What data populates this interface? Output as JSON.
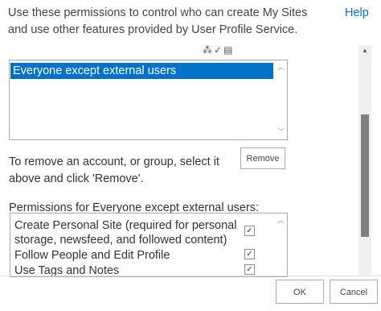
{
  "header": {
    "description": "Use these permissions to control who can create My Sites and use other features provided by User Profile Service.",
    "help_link": "Help"
  },
  "accounts": {
    "items": [
      "Everyone except external users"
    ],
    "selected_index": 0
  },
  "remove": {
    "instruction": "To remove an account, or group, select it above and click 'Remove'.",
    "button_label": "Remove"
  },
  "permissions": {
    "label": "Permissions for Everyone except external users:",
    "items": [
      {
        "label": "Create Personal Site (required for personal storage, newsfeed, and followed content)",
        "checked": true
      },
      {
        "label": "Follow People and Edit Profile",
        "checked": true
      },
      {
        "label": "Use Tags and Notes",
        "checked": true
      }
    ]
  },
  "footer": {
    "ok_label": "OK",
    "cancel_label": "Cancel"
  },
  "icons": {
    "check": "✓",
    "people_picker": "people-icon",
    "address_book": "address-book-icon"
  },
  "colors": {
    "selection": "#0072c6",
    "link": "#0072c6"
  }
}
